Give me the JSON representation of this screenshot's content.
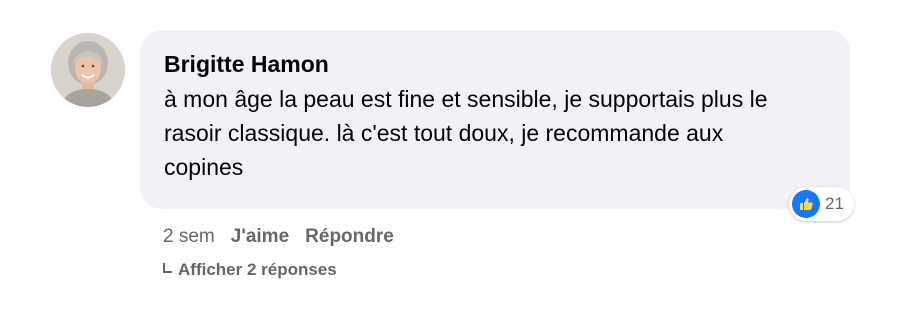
{
  "comment": {
    "author": "Brigitte Hamon",
    "text": "à mon âge la peau est fine et sensible, je supportais plus le rasoir classique. là c'est tout doux, je recommande aux copines",
    "reactions": {
      "icon": "thumbs-up-icon",
      "count": "21",
      "color": "#1877f2"
    },
    "timestamp": "2 sem",
    "like_label": "J'aime",
    "reply_label": "Répondre",
    "view_replies_label": "Afficher 2 réponses"
  },
  "colors": {
    "bubble_bg": "#f0f2f5",
    "text": "#050505",
    "secondary_text": "#65676b"
  }
}
